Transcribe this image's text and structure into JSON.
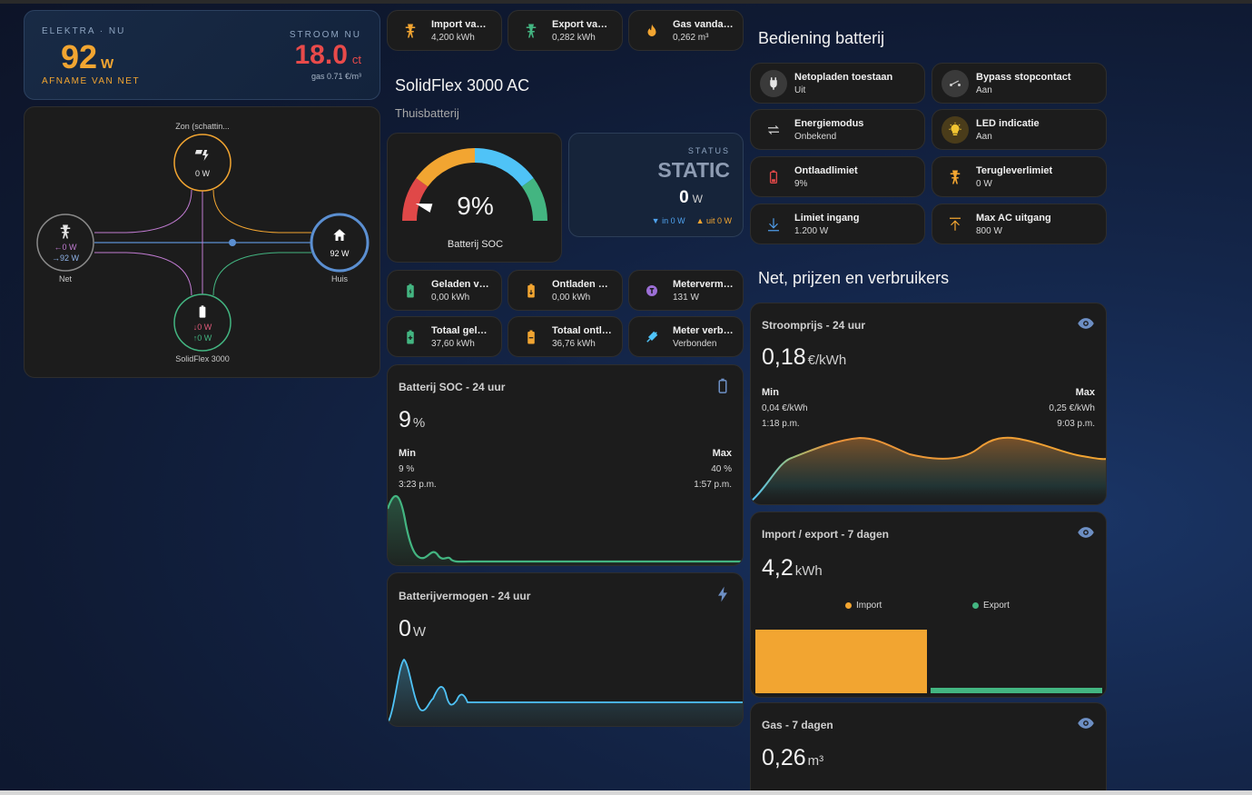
{
  "energy_header": {
    "left_caption": "ELEKTRA · NU",
    "power_value": "92",
    "power_unit": "W",
    "power_label": "AFNAME VAN NET",
    "right_caption": "STROOM NU",
    "price_value": "18.0",
    "price_unit": "ct",
    "gas_text": "gas 0.71 €/m³"
  },
  "flow": {
    "solar_label": "Zon (schattin...",
    "solar_value": "0 W",
    "grid_label": "Net",
    "grid_in": "←0 W",
    "grid_out": "→92 W",
    "home_label": "Huis",
    "home_value": "92 W",
    "battery_label": "SolidFlex 3000",
    "battery_in": "↓0 W",
    "battery_out": "↑0 W"
  },
  "top_tiles": [
    {
      "name": "Import vand...",
      "state": "4,200 kWh",
      "icon": "transmission-tower-import-icon",
      "color": "#f2a531"
    },
    {
      "name": "Export vand...",
      "state": "0,282 kWh",
      "icon": "transmission-tower-export-icon",
      "color": "#43b581"
    },
    {
      "name": "Gas vandaag",
      "state": "0,262 m³",
      "icon": "fire-icon",
      "color": "#f2a531"
    }
  ],
  "battery_section": {
    "title": "SolidFlex 3000 AC",
    "subtitle": "Thuisbatterij",
    "soc_value": "9%",
    "soc_label": "Batterij SOC",
    "soc_fraction": 0.09,
    "status_caption": "STATUS",
    "status_value": "STATIC",
    "status_power": "0",
    "status_power_unit": "W",
    "status_in": "▼ in 0 W",
    "status_out": "▲ uit 0 W"
  },
  "mid_tiles": [
    {
      "name": "Geladen van...",
      "state": "0,00 kWh",
      "icon": "battery-charging-icon",
      "color": "#43b581"
    },
    {
      "name": "Ontladen va...",
      "state": "0,00 kWh",
      "icon": "battery-discharging-icon",
      "color": "#f2a531"
    },
    {
      "name": "Metervermo...",
      "state": "131 W",
      "icon": "meter-icon",
      "color": "#9c6fd6"
    },
    {
      "name": "Totaal gelad...",
      "state": "37,60 kWh",
      "icon": "battery-plus-icon",
      "color": "#43b581"
    },
    {
      "name": "Totaal ontla...",
      "state": "36,76 kWh",
      "icon": "battery-minus-icon",
      "color": "#f2a531"
    },
    {
      "name": "Meter verbo...",
      "state": "Verbonden",
      "icon": "connection-icon",
      "color": "#4fc3f7"
    }
  ],
  "soc_graph": {
    "title": "Batterij SOC - 24 uur",
    "value": "9",
    "unit": "%",
    "min_label": "Min",
    "min_value": "9 %",
    "min_time": "3:23 p.m.",
    "max_label": "Max",
    "max_value": "40 %",
    "max_time": "1:57 p.m.",
    "icon": "battery-icon"
  },
  "power_graph": {
    "title": "Batterijvermogen - 24 uur",
    "value": "0",
    "unit": "W",
    "icon": "flash-icon"
  },
  "controls_section": {
    "title": "Bediening batterij",
    "tiles": [
      {
        "name": "Netopladen toestaan",
        "state": "Uit",
        "icon": "power-plug-icon",
        "color": "#cfcfcf"
      },
      {
        "name": "Bypass stopcontact",
        "state": "Aan",
        "icon": "switch-icon",
        "color": "#cfcfcf"
      },
      {
        "name": "Energiemodus",
        "state": "Onbekend",
        "icon": "swap-icon",
        "color": "#cfcfcf"
      },
      {
        "name": "LED indicatie",
        "state": "Aan",
        "icon": "lightbulb-icon",
        "color": "#f2c531"
      },
      {
        "name": "Ontlaadlimiet",
        "state": "9%",
        "icon": "battery-low-icon",
        "color": "#e04848"
      },
      {
        "name": "Terugleverlimiet",
        "state": "0 W",
        "icon": "transmission-tower-icon",
        "color": "#f2a531"
      },
      {
        "name": "Limiet ingang",
        "state": "1.200 W",
        "icon": "arrow-down-icon",
        "color": "#4f9ce8"
      },
      {
        "name": "Max AC uitgang",
        "state": "800 W",
        "icon": "arrow-up-icon",
        "color": "#f2a531"
      }
    ]
  },
  "net_section": {
    "title": "Net, prijzen en verbruikers"
  },
  "price_graph": {
    "title": "Stroomprijs - 24 uur",
    "value": "0,18",
    "unit": "€/kWh",
    "min_label": "Min",
    "min_value": "0,04 €/kWh",
    "min_time": "1:18 p.m.",
    "max_label": "Max",
    "max_value": "0,25 €/kWh",
    "max_time": "9:03 p.m.",
    "icon": "eye-icon"
  },
  "import_export": {
    "title": "Import / export - 7 dagen",
    "value": "4,2",
    "unit": "kWh",
    "legend_import": "Import",
    "legend_export": "Export",
    "import_color": "#f2a531",
    "export_color": "#43b581",
    "import_kwh": 4.2,
    "export_kwh": 0.282,
    "icon": "eye-icon"
  },
  "gas_graph": {
    "title": "Gas - 7 dagen",
    "value": "0,26",
    "unit": "m³",
    "icon": "eye-icon"
  }
}
